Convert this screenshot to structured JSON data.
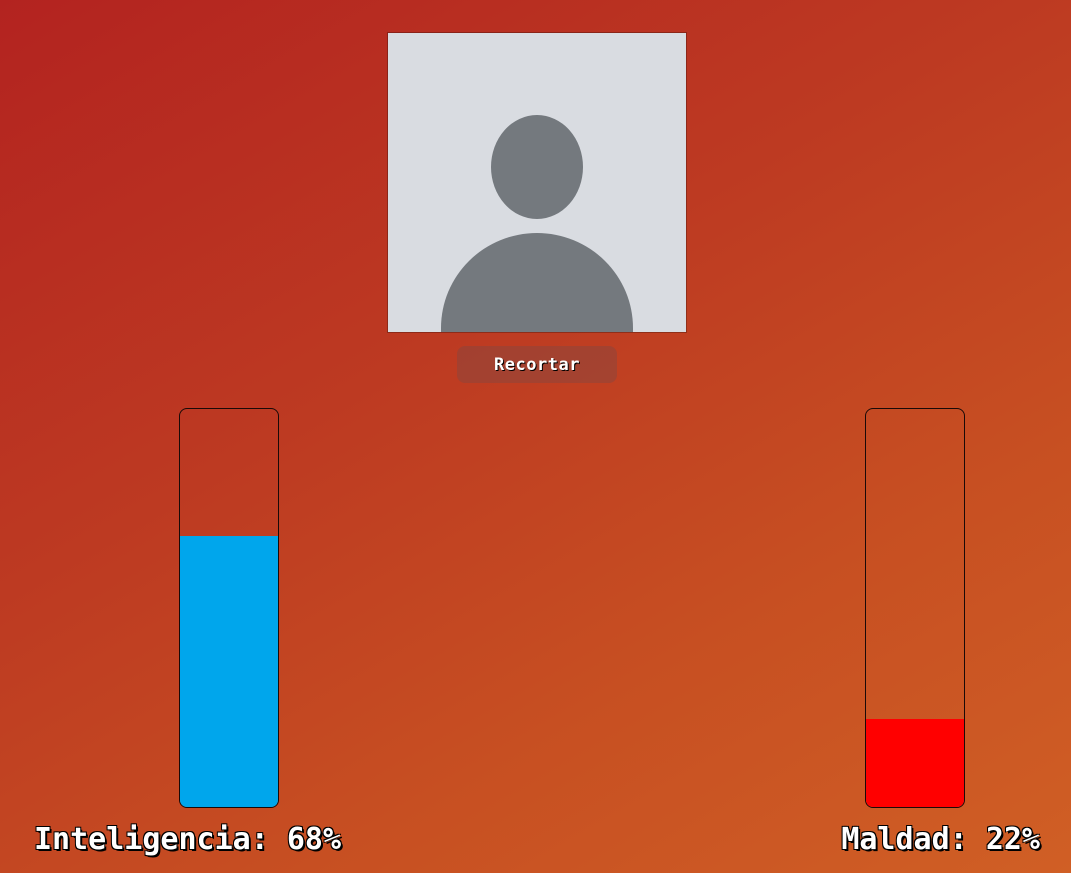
{
  "avatar": {
    "icon": "default-user-silhouette-icon",
    "background_color": "#d9dce1",
    "figure_color": "#74797e"
  },
  "crop_button": {
    "label": "Recortar"
  },
  "stats": [
    {
      "name": "Inteligencia",
      "label_text": "Inteligencia:",
      "value_text": "68%",
      "value": 68,
      "color": "#00a6ec"
    },
    {
      "name": "Maldad",
      "label_text": "Maldad:",
      "value_text": "22%",
      "value": 22,
      "color": "#ff0000"
    }
  ]
}
